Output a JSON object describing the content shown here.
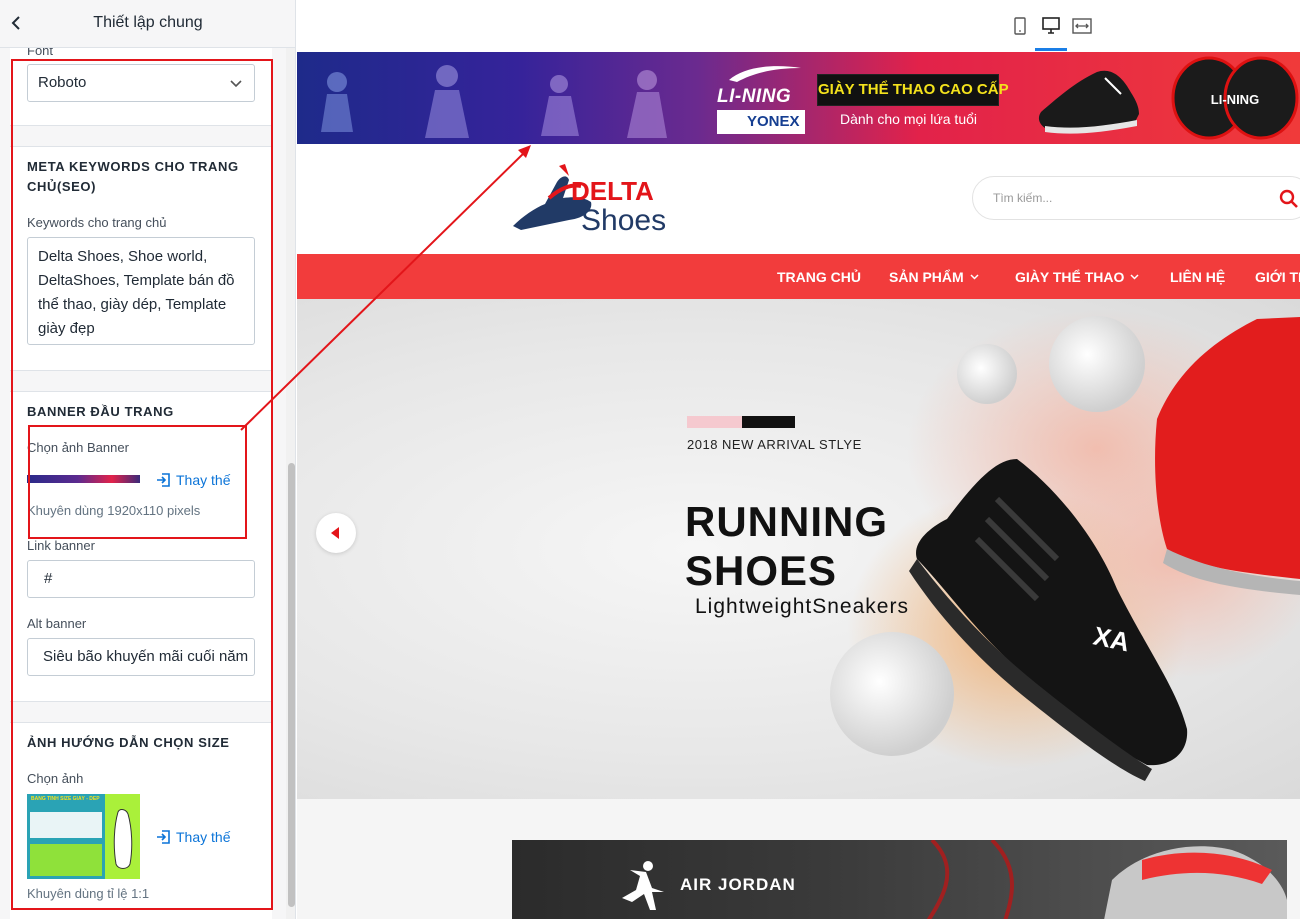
{
  "panel": {
    "title": "Thiết lập chung",
    "partial_label": "Font",
    "font_value": "Roboto",
    "meta": {
      "title": "META KEYWORDS CHO TRANG CHỦ(SEO)",
      "label": "Keywords cho trang chủ",
      "value": "Delta Shoes, Shoe world, DeltaShoes, Template bán đồ thể thao, giày dép, Template giày đẹp"
    },
    "banner": {
      "title": "BANNER ĐẦU TRANG",
      "choose_label": "Chọn ảnh Banner",
      "replace_label": "Thay thế",
      "hint": "Khuyên dùng 1920x110 pixels",
      "link_label": "Link banner",
      "link_value": "#",
      "alt_label": "Alt banner",
      "alt_value": "Siêu bão khuyến mãi cuối năm"
    },
    "size_guide": {
      "title": "ẢNH HƯỚNG DẪN CHỌN SIZE",
      "choose_label": "Chọn ảnh",
      "replace_label": "Thay thế",
      "hint": "Khuyên dùng tỉ lệ 1:1",
      "thumb_title": "BẢNG TÍNH SIZE GIÀY - DÉP"
    }
  },
  "device_bar": {
    "icons": [
      "mobile-icon",
      "desktop-icon",
      "fullwidth-icon"
    ],
    "active": "desktop-icon"
  },
  "site": {
    "top_banner": {
      "brand1": "LI-NING",
      "brand2": "YONEX",
      "headline": "GIÀY THỂ THAO CAO CẤP",
      "sub": "Dành cho mọi lứa tuổi",
      "racket_text": "LI-NING"
    },
    "logo": {
      "line1": "DELTA",
      "line2": "Shoes"
    },
    "search_placeholder": "Tìm kiếm...",
    "nav": [
      {
        "label": "TRANG CHỦ",
        "has_dropdown": false
      },
      {
        "label": "SẢN PHẨM",
        "has_dropdown": true
      },
      {
        "label": "GIÀY THỂ THAO",
        "has_dropdown": true
      },
      {
        "label": "LIÊN HỆ",
        "has_dropdown": false
      },
      {
        "label": "GIỚI TH",
        "has_dropdown": false
      }
    ],
    "hero": {
      "kicker": "2018 NEW ARRIVAL STLYE",
      "title": "RUNNING\nSHOES",
      "subtitle": "LightweightSneakers",
      "shoe_mark": "XA"
    },
    "promo2": {
      "label": "AIR JORDAN"
    }
  },
  "colors": {
    "accent_red": "#f23c3c",
    "annotation_red": "#e3151a",
    "link_blue": "#0b74d8"
  }
}
